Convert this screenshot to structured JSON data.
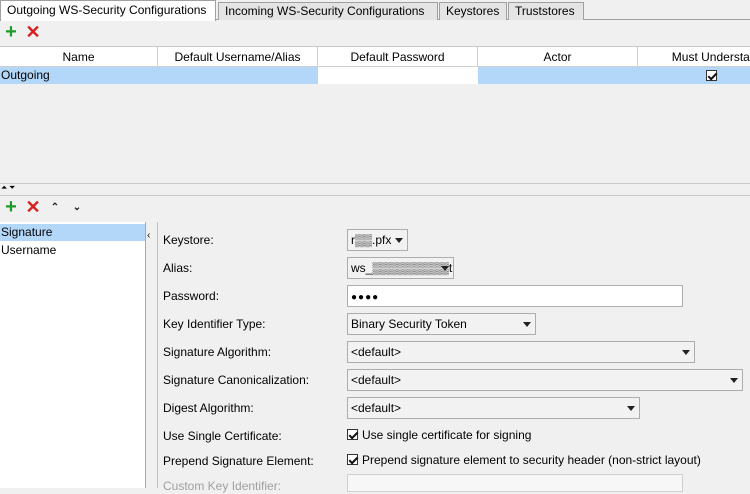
{
  "tabs": [
    {
      "label": "Outgoing WS-Security Configurations"
    },
    {
      "label": "Incoming WS-Security Configurations"
    },
    {
      "label": "Keystores"
    },
    {
      "label": "Truststores"
    }
  ],
  "toolbar_icons": [
    "add-icon",
    "delete-icon"
  ],
  "table": {
    "columns": [
      "Name",
      "Default Username/Alias",
      "Default Password",
      "Actor",
      "Must Understand"
    ],
    "rows": [
      {
        "name": "Outgoing",
        "username": "",
        "password": "",
        "actor": "",
        "must_understand": true
      }
    ]
  },
  "entry_toolbar_icons": [
    "add-icon",
    "delete-icon",
    "move-up-icon",
    "move-down-icon"
  ],
  "entries": [
    {
      "label": "Signature",
      "selected": true
    },
    {
      "label": "Username",
      "selected": false
    }
  ],
  "form": {
    "keystore": {
      "label": "Keystore:",
      "value": "r▒▒.pfx"
    },
    "alias": {
      "label": "Alias:",
      "value": "ws_▒▒▒▒▒▒▒▒▒t"
    },
    "password": {
      "label": "Password:",
      "value": "●●●●"
    },
    "key_identifier_type": {
      "label": "Key Identifier Type:",
      "value": "Binary Security Token"
    },
    "signature_algorithm": {
      "label": "Signature Algorithm:",
      "value": "<default>"
    },
    "signature_canonicalization": {
      "label": "Signature Canonicalization:",
      "value": "<default>"
    },
    "digest_algorithm": {
      "label": "Digest Algorithm:",
      "value": "<default>"
    },
    "use_single_certificate": {
      "label": "Use Single Certificate:",
      "checkbox_label": "Use single certificate for signing",
      "checked": true
    },
    "prepend_signature_element": {
      "label": "Prepend Signature Element:",
      "checkbox_label": "Prepend signature element to security header (non-strict layout)",
      "checked": true
    },
    "custom_key_identifier": {
      "label": "Custom Key Identifier:",
      "value": ""
    }
  },
  "colors": {
    "selection": "#b3d7f8",
    "add": "#1e9a2a",
    "delete": "#d92020"
  }
}
